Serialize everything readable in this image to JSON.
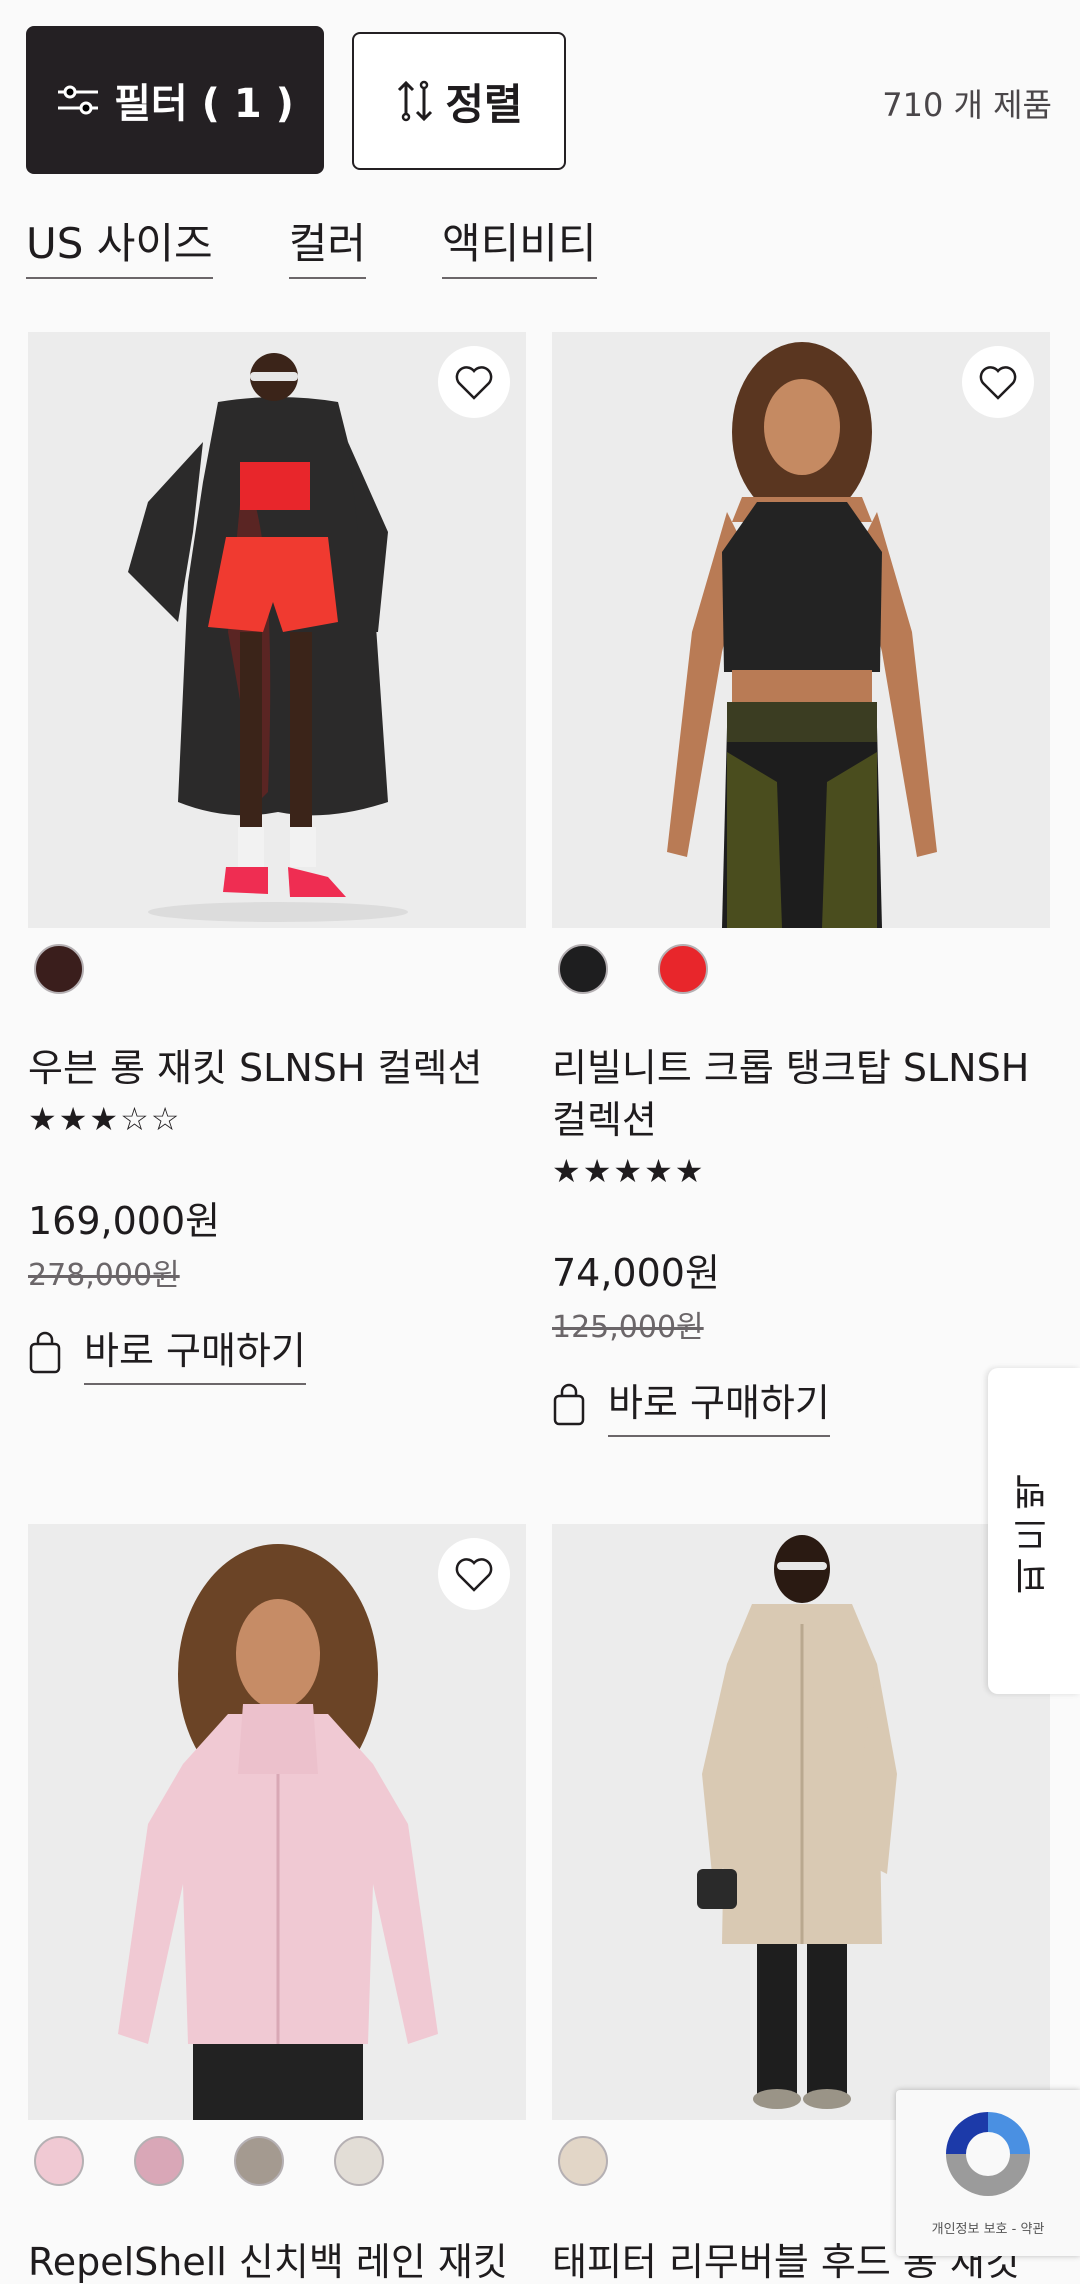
{
  "toolbar": {
    "filter_label": "필터 ( 1 )",
    "sort_label": "정렬",
    "product_count": "710 개 제품"
  },
  "filters": [
    "US 사이즈",
    "컬러",
    "액티비티"
  ],
  "products": [
    {
      "name": "우븐 롱 재킷 SLNSH 컬렉션",
      "stars": "★★★☆☆",
      "price": "169,000원",
      "original_price": "278,000원",
      "buy_label": "바로 구매하기",
      "swatch_colors": [
        "#3a1e1c"
      ]
    },
    {
      "name": "리빌니트 크롭 탱크탑 SLNSH 컬렉션",
      "stars": "★★★★★",
      "price": "74,000원",
      "original_price": "125,000원",
      "buy_label": "바로 구매하기",
      "swatch_colors": [
        "#1e1e1f",
        "#e8262b"
      ]
    },
    {
      "name": "RepelShell 신치백 레인 재킷",
      "swatch_colors": [
        "#f0c9d3",
        "#d9a7b7",
        "#a49a90",
        "#e2ddd6"
      ]
    },
    {
      "name": "태피터 리무버블 후드 롱 재킷",
      "swatch_colors": [
        "#e2d6c7"
      ]
    }
  ],
  "feedback_tab": "피드백",
  "recaptcha": {
    "terms": "개인정보 보호 - 약관"
  },
  "colors": {
    "primary_dark": "#24202 3",
    "background": "#fafafa"
  }
}
